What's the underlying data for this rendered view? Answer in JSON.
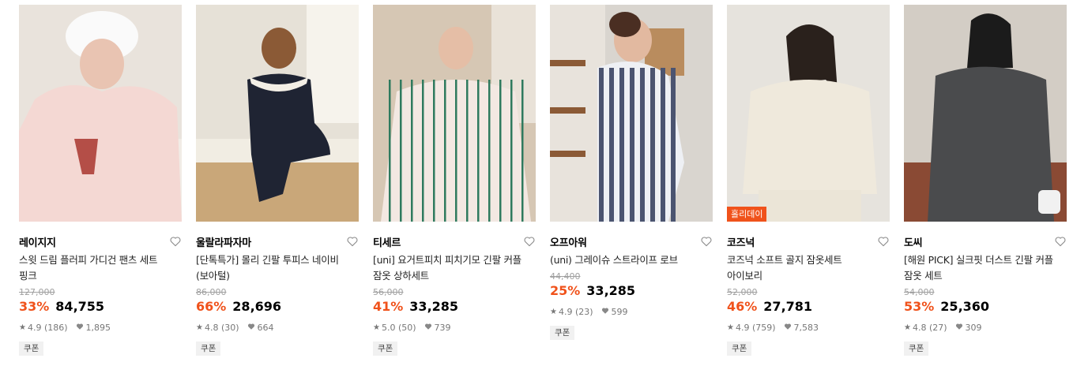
{
  "products": [
    {
      "brand": "레이지지",
      "name_line1": "스윗 드림 플러피 가디건 팬츠 세트",
      "name_line2": "핑크",
      "original_price": "127,000",
      "discount": "33%",
      "price": "84,755",
      "rating": "4.9 (186)",
      "likes": "1,895",
      "coupon": "쿠폰",
      "badge": "",
      "colors": {
        "bg": "#e9e3dc",
        "main": "#f4d8d3",
        "accent": "#f7f4ef"
      }
    },
    {
      "brand": "울랄라파자마",
      "name_line1": "[단톡특가] 몰리 긴팔 투피스 네이비",
      "name_line2": "(보아털)",
      "original_price": "86,000",
      "discount": "66%",
      "price": "28,696",
      "rating": "4.8 (30)",
      "likes": "664",
      "coupon": "쿠폰",
      "badge": "",
      "colors": {
        "bg": "#d8d2c6",
        "main": "#1f2433",
        "accent": "#f3efe6"
      }
    },
    {
      "brand": "티세르",
      "name_line1": "[uni] 요거트피치 피치기모 긴팔 커플",
      "name_line2": "잠옷 상하세트",
      "original_price": "56,000",
      "discount": "41%",
      "price": "33,285",
      "rating": "5.0 (50)",
      "likes": "739",
      "coupon": "쿠폰",
      "badge": "",
      "colors": {
        "bg": "#c9b9a4",
        "main": "#f3e8e2",
        "accent": "#2f7a5e"
      }
    },
    {
      "brand": "오프아워",
      "name_line1": "(uni) 그레이슈 스트라이프 로브",
      "name_line2": "",
      "original_price": "44,400",
      "discount": "25%",
      "price": "33,285",
      "rating": "4.9 (23)",
      "likes": "599",
      "coupon": "쿠폰",
      "badge": "",
      "colors": {
        "bg": "#d9d5cf",
        "main": "#eef0f4",
        "accent": "#4b5470"
      }
    },
    {
      "brand": "코즈넉",
      "name_line1": "코즈넉 소프트 골지 잠옷세트",
      "name_line2": "아이보리",
      "original_price": "52,000",
      "discount": "46%",
      "price": "27,781",
      "rating": "4.9 (759)",
      "likes": "7,583",
      "coupon": "쿠폰",
      "badge": "홀리데이",
      "colors": {
        "bg": "#e6e3dd",
        "main": "#efe9dc",
        "accent": "#2a211c"
      }
    },
    {
      "brand": "도씨",
      "name_line1": "[해원 PICK] 실크핏 더스트 긴팔 커플",
      "name_line2": "잠옷 세트",
      "original_price": "54,000",
      "discount": "53%",
      "price": "25,360",
      "rating": "4.8 (27)",
      "likes": "309",
      "coupon": "쿠폰",
      "badge": "",
      "colors": {
        "bg": "#d3cdc5",
        "main": "#4a4b4d",
        "accent": "#8a4a34"
      }
    }
  ],
  "ui": {
    "accent": "#f0521b",
    "heart_icon": "heart-outline-icon",
    "star_icon": "star-icon",
    "like_icon": "heart-filled-icon"
  }
}
